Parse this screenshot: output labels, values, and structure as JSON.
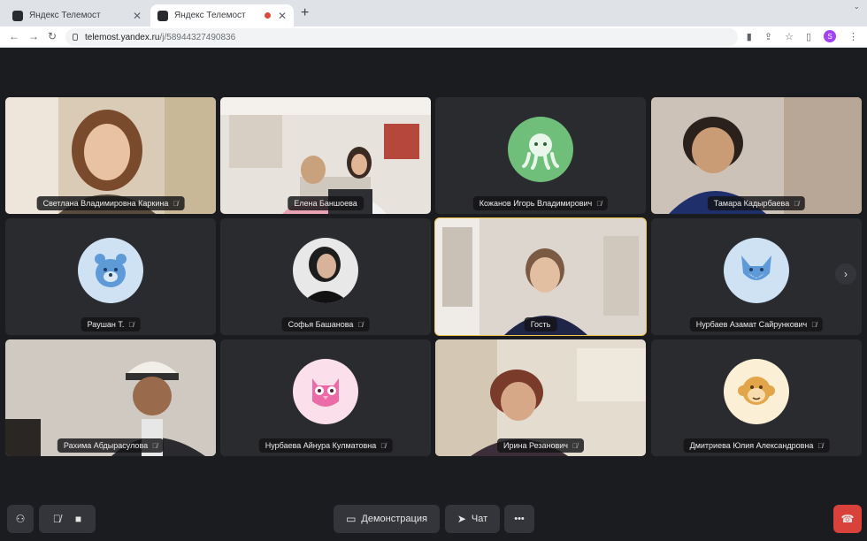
{
  "browser": {
    "tabs": [
      {
        "title": "Яндекс Телемост",
        "active": false
      },
      {
        "title": "Яндекс Телемост",
        "active": true
      }
    ],
    "new_tab": "+",
    "window_control": "⌄",
    "url_host": "telemost.yandex.ru",
    "url_path": "/j/58944327490836",
    "profile_initial": "S"
  },
  "participants": [
    {
      "name": "Светлана Владимировна Каркина",
      "kind": "video"
    },
    {
      "name": "Елена Баншоева",
      "kind": "video"
    },
    {
      "name": "Кожанов Игорь Владимирович",
      "kind": "avatar",
      "avatar": "octopus-icon",
      "color": "#6fbf7b"
    },
    {
      "name": "Тамара Кадырбаева",
      "kind": "video"
    },
    {
      "name": "Раушан Т.",
      "kind": "avatar",
      "avatar": "bear-icon",
      "color": "#5f9ad8"
    },
    {
      "name": "Софья Башанова",
      "kind": "avatar",
      "avatar": "person-photo",
      "color": "#2b2b2b"
    },
    {
      "name": "Гость",
      "kind": "video",
      "speaking": true
    },
    {
      "name": "Нурбаев Азамат Сайрункович",
      "kind": "avatar",
      "avatar": "fox-icon",
      "color": "#5f9ad8"
    },
    {
      "name": "Рахима Абдырасулова",
      "kind": "video"
    },
    {
      "name": "Нурбаева Айнура Кулматовна",
      "kind": "avatar",
      "avatar": "owl-icon",
      "color": "#ec6aa8"
    },
    {
      "name": "Ирина Резанович",
      "kind": "video"
    },
    {
      "name": "Дмитриева Юлия Александровна",
      "kind": "avatar",
      "avatar": "monkey-icon",
      "color": "#e3a54a"
    }
  ],
  "controls": {
    "demo_label": "Демонстрация",
    "chat_label": "Чат",
    "more_label": "•••"
  }
}
